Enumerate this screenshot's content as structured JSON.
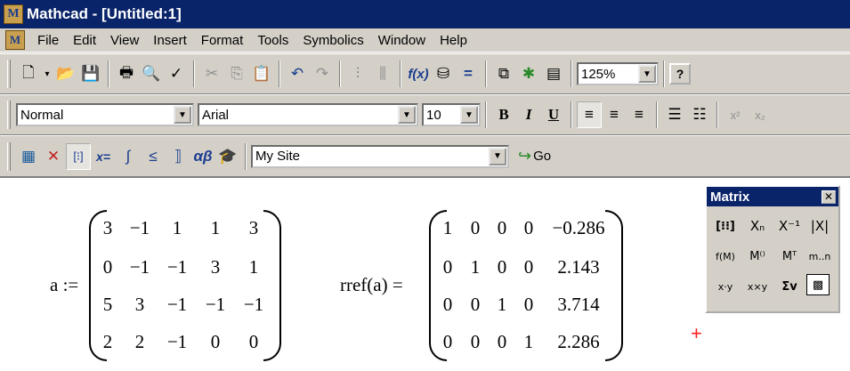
{
  "window": {
    "title": "Mathcad - [Untitled:1]",
    "app_icon": "M"
  },
  "menu": [
    "File",
    "Edit",
    "View",
    "Insert",
    "Format",
    "Tools",
    "Symbolics",
    "Window",
    "Help"
  ],
  "toolbar_standard": {
    "zoom": "125%"
  },
  "toolbar_format": {
    "style": "Normal",
    "font": "Arial",
    "size": "10",
    "bold": "B",
    "italic": "I",
    "underline": "U"
  },
  "toolbar_math": {
    "site": "My Site",
    "go": "Go"
  },
  "worksheet": {
    "lhs_label": "a :=",
    "a": [
      [
        "3",
        "−1",
        "1",
        "1",
        "3"
      ],
      [
        "0",
        "−1",
        "−1",
        "3",
        "1"
      ],
      [
        "5",
        "3",
        "−1",
        "−1",
        "−1"
      ],
      [
        "2",
        "2",
        "−1",
        "0",
        "0"
      ]
    ],
    "rhs_label": "rref(a) =",
    "rref": [
      [
        "1",
        "0",
        "0",
        "0",
        "−0.286"
      ],
      [
        "0",
        "1",
        "0",
        "0",
        "2.143"
      ],
      [
        "0",
        "0",
        "1",
        "0",
        "3.714"
      ],
      [
        "0",
        "0",
        "0",
        "1",
        "2.286"
      ]
    ]
  },
  "palette": {
    "title": "Matrix"
  }
}
